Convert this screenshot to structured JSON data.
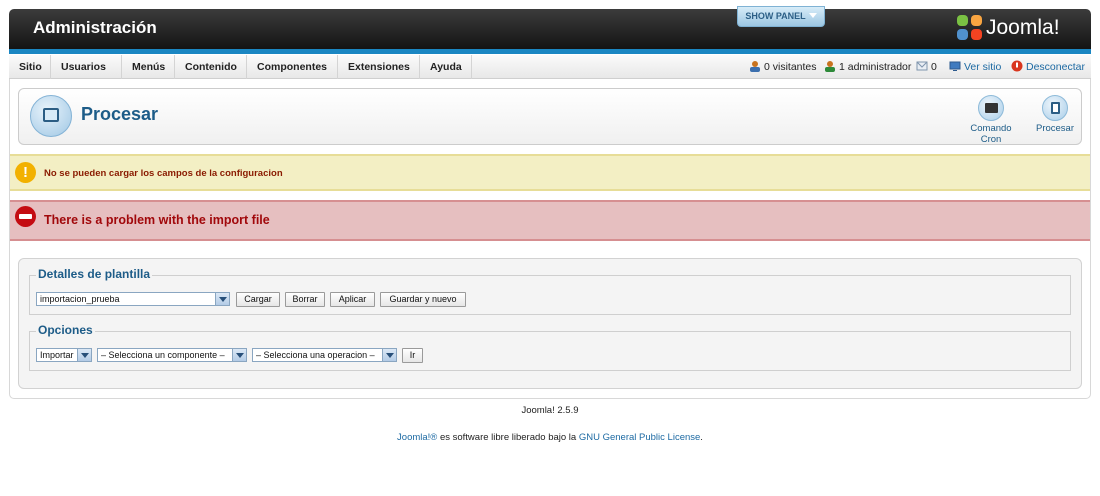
{
  "header": {
    "title": "Administración",
    "show_panel_label": "SHOW PANEL",
    "logo_text": "Joomla!"
  },
  "menu": {
    "items": [
      {
        "label": "Sitio"
      },
      {
        "label": "Usuarios"
      },
      {
        "label": "Menús"
      },
      {
        "label": "Contenido"
      },
      {
        "label": "Componentes"
      },
      {
        "label": "Extensiones"
      },
      {
        "label": "Ayuda"
      }
    ]
  },
  "status": {
    "visitors": "0 visitantes",
    "admins": "1 administrador",
    "messages": "0",
    "view_site": "Ver sitio",
    "logout": "Desconectar"
  },
  "toolbar": {
    "page_title": "Procesar",
    "buttons": [
      {
        "label": "Comando Cron",
        "icon": "cron-command-icon"
      },
      {
        "label": "Procesar",
        "icon": "process-icon"
      }
    ]
  },
  "messages": {
    "warning": "No se pueden cargar los campos de la configuracion",
    "error": "There is a problem with the import file"
  },
  "template_details": {
    "legend": "Detalles de plantilla",
    "template_select_value": "importacion_prueba",
    "buttons": {
      "load": "Cargar",
      "delete": "Borrar",
      "apply": "Aplicar",
      "save_new": "Guardar y nuevo"
    }
  },
  "options": {
    "legend": "Opciones",
    "action_select_value": "Importar",
    "component_select_value": "– Selecciona un componente –",
    "operation_select_value": "– Selecciona una operacion –",
    "go_button": "Ir"
  },
  "footer": {
    "version": "Joomla! 2.5.9",
    "joomla_link": "Joomla!®",
    "license_text": " es software libre liberado bajo la ",
    "license_link": "GNU General Public License",
    "period": "."
  },
  "colors": {
    "header_dark": "#1e1e1e",
    "stripe_blue": "#1a86c2",
    "title_blue": "#1d5c88",
    "warning_bg": "#f3efc4",
    "error_bg": "#e6bfc0",
    "error_text": "#a1080b"
  }
}
